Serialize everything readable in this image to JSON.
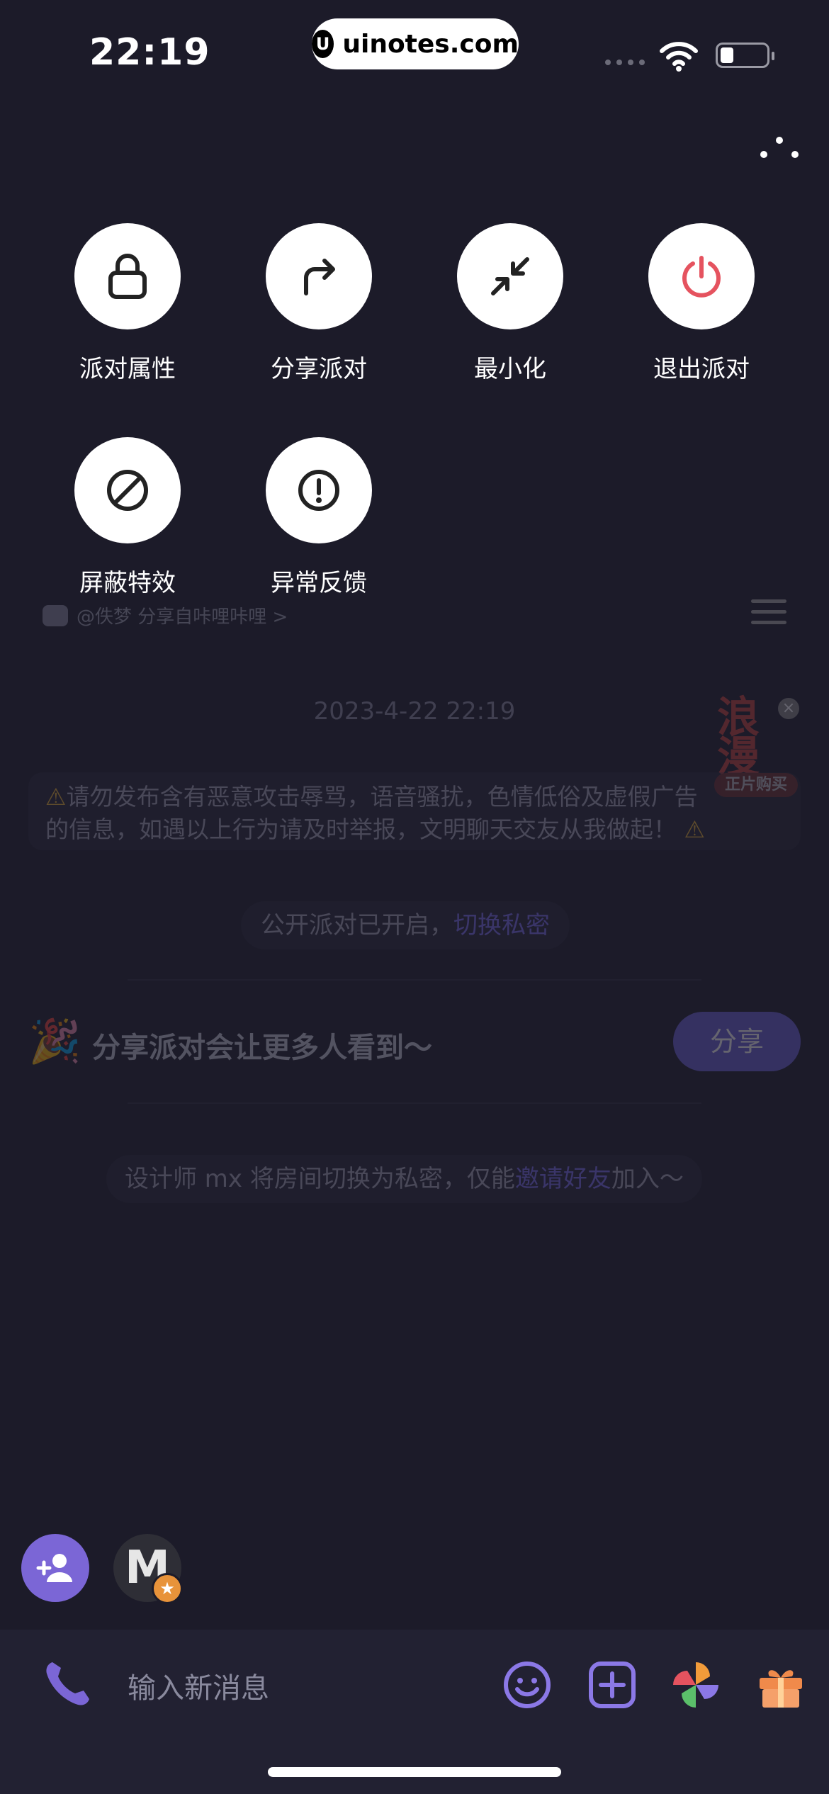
{
  "status_bar": {
    "time": "22:19",
    "site": "uinotes.com",
    "site_logo_letter": "U"
  },
  "actions": [
    {
      "label": "派对属性",
      "icon": "lock-icon"
    },
    {
      "label": "分享派对",
      "icon": "share-arrow-icon"
    },
    {
      "label": "最小化",
      "icon": "minimize-icon"
    },
    {
      "label": "退出派对",
      "icon": "power-icon",
      "icon_color": "#e5535f"
    },
    {
      "label": "屏蔽特效",
      "icon": "block-icon"
    },
    {
      "label": "异常反馈",
      "icon": "exclamation-icon"
    }
  ],
  "chat": {
    "notice": "@佚梦 分享自咔哩咔哩 >",
    "date": "2023-4-22 22:19",
    "warning_line1": "请勿发布含有恶意攻击辱骂，语音骚扰，色情低俗及虚假广告",
    "warning_line2": "的信息，如遇以上行为请及时举报，文明聊天交友从我做起！",
    "sticker_art": "浪漫",
    "sticker_tag": "正片购买",
    "public_text": "公开派对已开启，",
    "public_link": "切换私密",
    "share_text": "分享派对会让更多人看到～",
    "share_button": "分享",
    "private_text": "设计师 mx 将房间切换为私密，仅能",
    "private_link": "邀请好友",
    "private_suffix": "加入～"
  },
  "seats": {
    "avatar_letter": "M"
  },
  "input": {
    "placeholder": "输入新消息"
  },
  "colors": {
    "background": "#1c1b29",
    "accent": "#7b66d6",
    "exit_red": "#e5535f"
  }
}
